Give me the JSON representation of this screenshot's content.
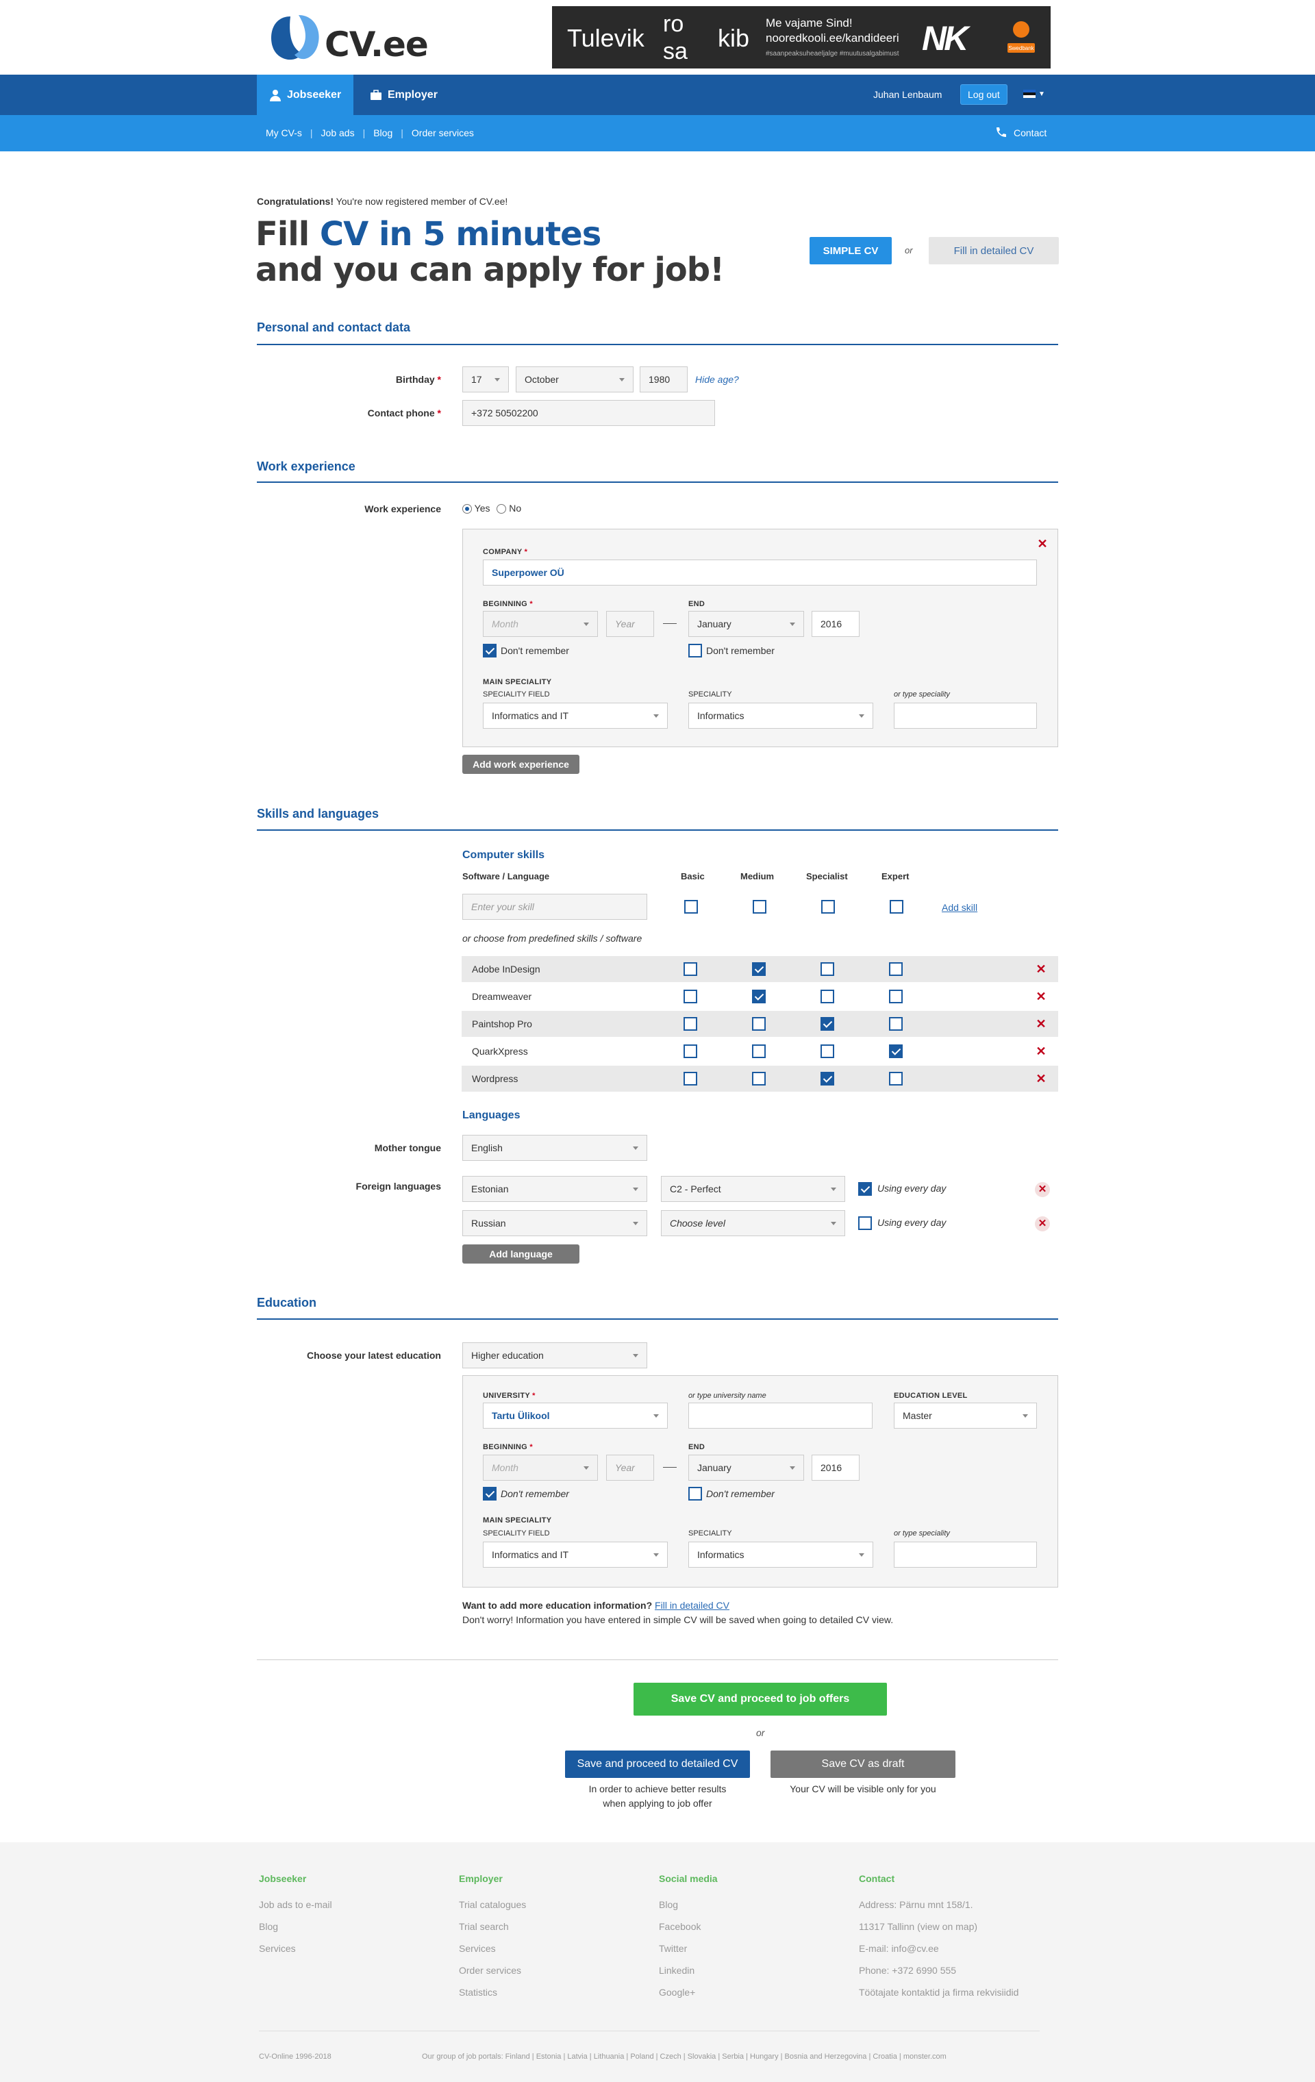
{
  "header": {
    "logo_text": "CV.ee",
    "banner": {
      "word1": "Tulevik",
      "word2a": "ro",
      "word2b": "sa",
      "word3": "kib",
      "line1": "Me vajame Sind!",
      "line2": "nooredkooli.ee/kandideeri",
      "tags": "#saanpeaksuheaeljalge   #muutusalgabimust",
      "mark": "NK",
      "sponsor": "Swedbank"
    }
  },
  "nav": {
    "tabs": [
      "Jobseeker",
      "Employer"
    ],
    "user": "Juhan Lenbaum",
    "logout": "Log out",
    "sub": [
      "My CV-s",
      "Job ads",
      "Blog",
      "Order services"
    ],
    "contact": "Contact"
  },
  "intro": {
    "congrats_bold": "Congratulations!",
    "congrats_rest": " You're now registered member of CV.ee!",
    "h1_fill": "Fill ",
    "h1_blue": "CV in 5 minutes",
    "h1_line2": "and you can apply for job!",
    "simple_cv": "SIMPLE CV",
    "or": "or",
    "detailed_cv": "Fill in detailed CV"
  },
  "personal": {
    "title": "Personal and contact data",
    "birthday_label": "Birthday",
    "day": "17",
    "month": "October",
    "year": "1980",
    "hide_age": "Hide age?",
    "phone_label": "Contact phone",
    "phone": "+372 50502200"
  },
  "work": {
    "title": "Work experience",
    "label": "Work experience",
    "yes": "Yes",
    "no": "No",
    "company_label": "COMPANY",
    "company": "Superpower OÜ",
    "beginning_label": "BEGINNING",
    "month_ph": "Month",
    "year_ph": "Year",
    "end_label": "END",
    "end_month": "January",
    "end_year": "2016",
    "dont_remember": "Don't remember",
    "main_spec": "MAIN SPECIALITY",
    "spec_field_label": "SPECIALITY FIELD",
    "spec_field": "Informatics and IT",
    "spec_label": "SPECIALITY",
    "spec": "Informatics",
    "type_spec": "or type speciality",
    "add_btn": "Add work experience"
  },
  "skills": {
    "title": "Skills and languages",
    "computer_title": "Computer skills",
    "col_sw": "Software / Language",
    "cols": [
      "Basic",
      "Medium",
      "Specialist",
      "Expert"
    ],
    "enter_ph": "Enter your skill",
    "add_skill": "Add skill",
    "predefined": "or choose from predefined skills / software",
    "rows": [
      {
        "name": "Adobe InDesign",
        "level": 1
      },
      {
        "name": "Dreamweaver",
        "level": 1
      },
      {
        "name": "Paintshop Pro",
        "level": 2
      },
      {
        "name": "QuarkXpress",
        "level": 3
      },
      {
        "name": "Wordpress",
        "level": 2
      }
    ],
    "languages_title": "Languages",
    "mother_label": "Mother tongue",
    "mother": "English",
    "foreign_label": "Foreign languages",
    "foreign": [
      {
        "lang": "Estonian",
        "level": "C2 - Perfect",
        "daily": true
      },
      {
        "lang": "Russian",
        "level": "Choose level",
        "daily": false
      }
    ],
    "using_daily": "Using every day",
    "add_lang": "Add language"
  },
  "education": {
    "title": "Education",
    "choose_label": "Choose your latest  education",
    "choose": "Higher education",
    "univ_label": "UNIVERSITY",
    "univ": "Tartu Ülikool",
    "univ_type": "or type university name",
    "level_label": "EDUCATION LEVEL",
    "level": "Master",
    "beginning_label": "BEGINNING",
    "month_ph": "Month",
    "year_ph": "Year",
    "end_label": "END",
    "end_month": "January",
    "end_year": "2016",
    "dont_remember": "Don't remember",
    "main_spec": "MAIN SPECIALITY",
    "spec_field_label": "SPECIALITY FIELD",
    "spec_field": "Informatics and IT",
    "spec_label": "SPECIALITY",
    "spec": "Informatics",
    "type_spec": "or type speciality",
    "more_bold": "Want to add more education information?",
    "more_link": "Fill in detailed CV",
    "more_note": "Don't worry! Information you have entered in simple CV will be saved when going to detailed CV view."
  },
  "actions": {
    "save_proceed": "Save CV and proceed to job offers",
    "or": "or",
    "save_detailed": "Save and proceed to detailed CV",
    "save_detailed_note1": "In order to achieve better results",
    "save_detailed_note2": "when applying to job offer",
    "save_draft": "Save CV as draft",
    "save_draft_note": "Your CV will be visible only for you"
  },
  "footer": {
    "cols": [
      {
        "title": "Jobseeker",
        "items": [
          "Job ads to e-mail",
          "Blog",
          "Services"
        ]
      },
      {
        "title": "Employer",
        "items": [
          "Trial catalogues",
          "Trial search",
          "Services",
          "Order services",
          "Statistics"
        ]
      },
      {
        "title": "Social media",
        "items": [
          "Blog",
          "Facebook",
          "Twitter",
          "Linkedin",
          "Google+"
        ]
      },
      {
        "title": "Contact",
        "items": [
          "Address: Pärnu mnt 158/1.",
          "11317 Tallinn (view on map)",
          "E-mail: info@cv.ee",
          "Phone: +372 6990 555",
          "Töötajate kontaktid ja firma rekvisiidid"
        ]
      }
    ],
    "copy": "CV-Online 1996-2018",
    "group": "Our group of job portals: Finland | Estonia | Latvia | Lithuania | Poland | Czech | Slovakia | Serbia | Hungary | Bosnia and Herzegovina | Croatia | monster.com"
  },
  "colors": {
    "primary": "#1a5aa0",
    "accent": "#2590e3",
    "green": "#3dbb4a",
    "grey": "#777777"
  }
}
